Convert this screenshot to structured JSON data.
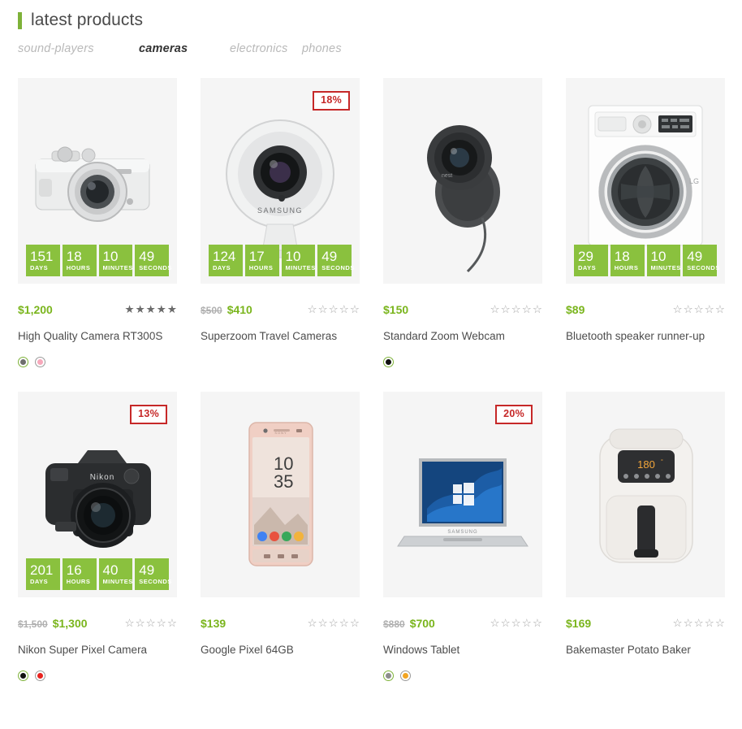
{
  "header": {
    "title": "latest products",
    "accent_color": "#7eb239",
    "tabs": [
      {
        "label": "sound-players",
        "active": false
      },
      {
        "label": "cameras",
        "active": true
      },
      {
        "label": "electronics",
        "active": false
      },
      {
        "label": "phones",
        "active": false
      }
    ]
  },
  "countdown_labels": {
    "days": "DAYS",
    "hours": "HOURS",
    "minutes": "MINUTES",
    "seconds": "SECONDS"
  },
  "colors": {
    "price": "#7ab51d",
    "countdown": "#8ac13e",
    "badge": "#c62828",
    "old_price": "#b0b0b0",
    "thumb_bg": "#f5f5f5"
  },
  "products": [
    {
      "name": "High Quality Camera RT300S",
      "price": "$1,200",
      "old_price": "",
      "rating": 5,
      "badge": "",
      "image": "mirrorless-camera-icon",
      "countdown": {
        "days": "151",
        "hours": "18",
        "minutes": "10",
        "seconds": "49"
      },
      "swatches": [
        {
          "color": "#6e6e6e",
          "selected": true
        },
        {
          "color": "#f7a8bb",
          "selected": false
        }
      ]
    },
    {
      "name": "Superzoom Travel Cameras",
      "price": "$410",
      "old_price": "$500",
      "rating": 0,
      "badge": "18%",
      "image": "dome-security-camera-icon",
      "countdown": {
        "days": "124",
        "hours": "17",
        "minutes": "10",
        "seconds": "49"
      },
      "swatches": []
    },
    {
      "name": "Standard Zoom Webcam",
      "price": "$150",
      "old_price": "",
      "rating": 0,
      "badge": "",
      "image": "wall-mount-camera-icon",
      "countdown": null,
      "swatches": [
        {
          "color": "#111111",
          "selected": true
        }
      ]
    },
    {
      "name": "Bluetooth speaker runner-up",
      "price": "$89",
      "old_price": "",
      "rating": 0,
      "badge": "",
      "image": "washing-machine-icon",
      "countdown": {
        "days": "29",
        "hours": "18",
        "minutes": "10",
        "seconds": "49"
      },
      "swatches": []
    },
    {
      "name": "Nikon Super Pixel Camera",
      "price": "$1,300",
      "old_price": "$1,500",
      "rating": 0,
      "badge": "13%",
      "image": "dslr-camera-icon",
      "countdown": {
        "days": "201",
        "hours": "16",
        "minutes": "40",
        "seconds": "49"
      },
      "swatches": [
        {
          "color": "#111111",
          "selected": true
        },
        {
          "color": "#e8231f",
          "selected": false
        }
      ]
    },
    {
      "name": "Google Pixel 64GB",
      "price": "$139",
      "old_price": "",
      "rating": 0,
      "badge": "",
      "image": "smartphone-icon",
      "countdown": null,
      "swatches": []
    },
    {
      "name": "Windows Tablet",
      "price": "$700",
      "old_price": "$880",
      "rating": 0,
      "badge": "20%",
      "image": "laptop-icon",
      "countdown": null,
      "swatches": [
        {
          "color": "#8d8d8d",
          "selected": true
        },
        {
          "color": "#f2a423",
          "selected": false
        }
      ]
    },
    {
      "name": "Bakemaster Potato Baker",
      "price": "$169",
      "old_price": "",
      "rating": 0,
      "badge": "",
      "image": "air-fryer-icon",
      "countdown": null,
      "swatches": []
    }
  ]
}
